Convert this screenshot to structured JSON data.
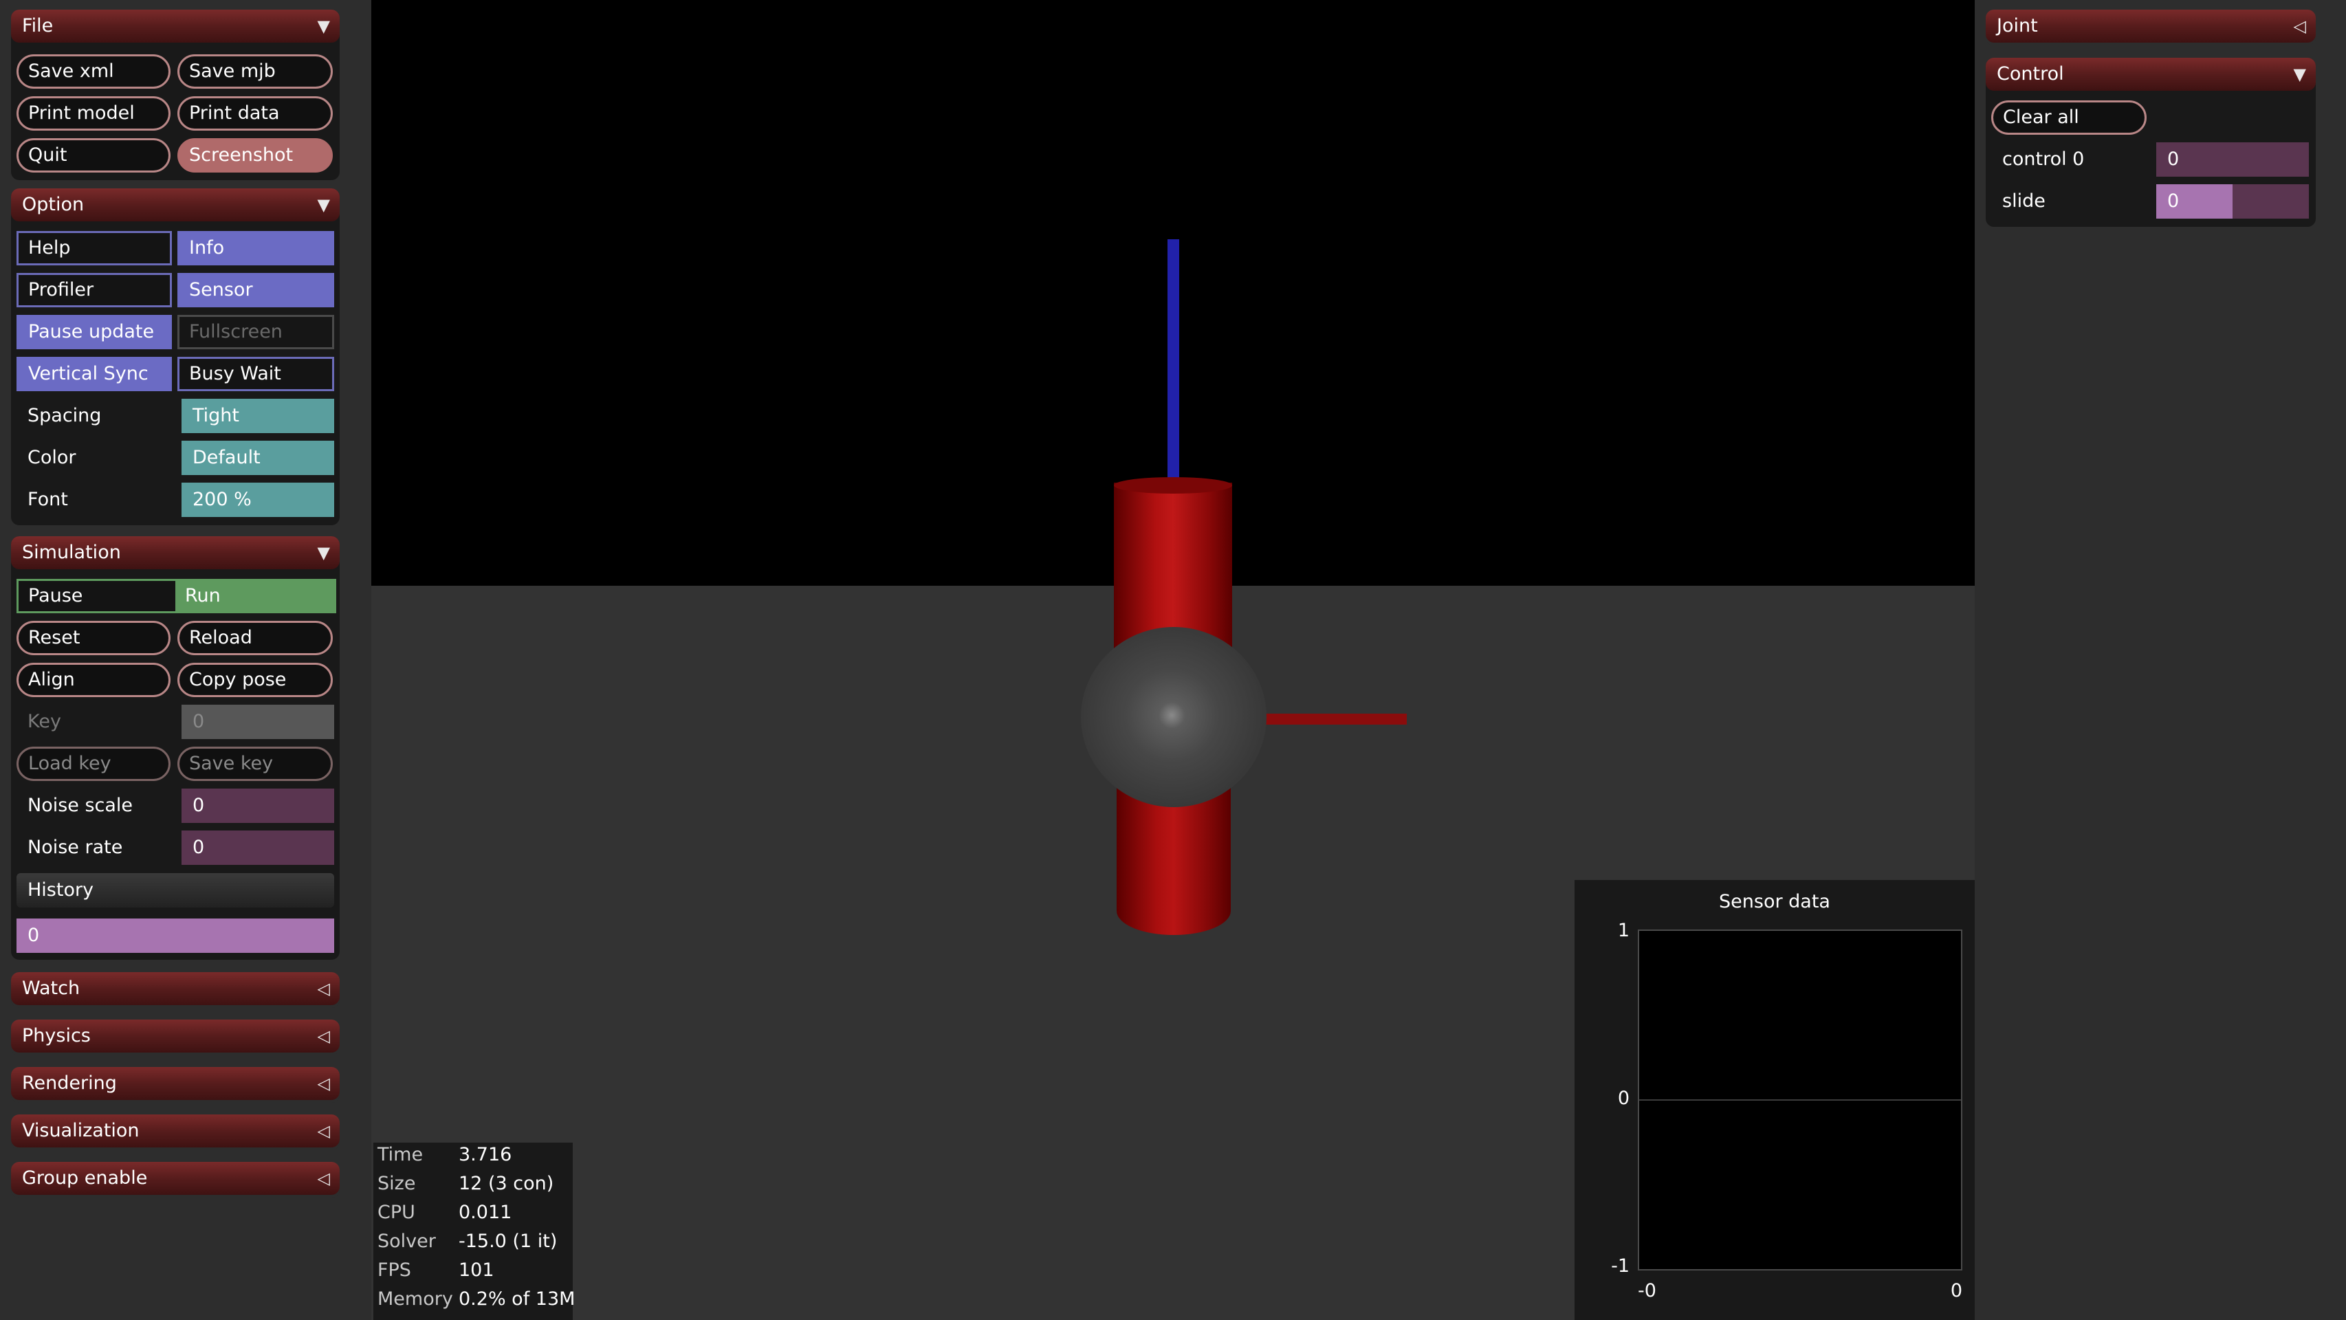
{
  "file": {
    "title": "File",
    "save_xml": "Save xml",
    "save_mjb": "Save mjb",
    "print_model": "Print model",
    "print_data": "Print data",
    "quit": "Quit",
    "screenshot": "Screenshot"
  },
  "option": {
    "title": "Option",
    "help": "Help",
    "info": "Info",
    "profiler": "Profiler",
    "sensor": "Sensor",
    "pause_update": "Pause update",
    "fullscreen": "Fullscreen",
    "vertical_sync": "Vertical Sync",
    "busy_wait": "Busy Wait",
    "spacing_label": "Spacing",
    "spacing_value": "Tight",
    "color_label": "Color",
    "color_value": "Default",
    "font_label": "Font",
    "font_value": "200 %"
  },
  "simulation": {
    "title": "Simulation",
    "pause": "Pause",
    "run": "Run",
    "reset": "Reset",
    "reload": "Reload",
    "align": "Align",
    "copy_pose": "Copy pose",
    "key_label": "Key",
    "key_value": "0",
    "load_key": "Load key",
    "save_key": "Save key",
    "noise_scale_label": "Noise scale",
    "noise_scale_value": "0",
    "noise_rate_label": "Noise rate",
    "noise_rate_value": "0",
    "history_label": "History",
    "history_value": "0"
  },
  "collapsed_sections": {
    "watch": "Watch",
    "physics": "Physics",
    "rendering": "Rendering",
    "visualization": "Visualization",
    "group_enable": "Group enable"
  },
  "right": {
    "joint_title": "Joint",
    "control_title": "Control",
    "clear_all": "Clear all",
    "control0_label": "control 0",
    "control0_value": "0",
    "slide_label": "slide",
    "slide_value": "0",
    "slide_fraction": 0.5
  },
  "stats": {
    "time_label": "Time",
    "time_value": "3.716",
    "size_label": "Size",
    "size_value": "12  (3 con)",
    "cpu_label": "CPU",
    "cpu_value": "0.011",
    "solver_label": "Solver",
    "solver_value": "-15.0  (1 it)",
    "fps_label": "FPS",
    "fps_value": "101",
    "memory_label": "Memory",
    "memory_value": "0.2% of 13M"
  },
  "sensor_plot": {
    "title": "Sensor data",
    "y_top": "1",
    "y_mid": "0",
    "y_bottom": "-1",
    "x_left": "-0",
    "x_right": "0"
  },
  "icons": {
    "expanded": "▼",
    "collapsed": "◁"
  },
  "colors": {
    "header_red": "#6b2222",
    "toggle_on": "#6b6bc4",
    "teal": "#5a9e9e",
    "run_green": "#5e9a5e",
    "field_purple": "#5a3550",
    "history_purple": "#a774b0"
  }
}
